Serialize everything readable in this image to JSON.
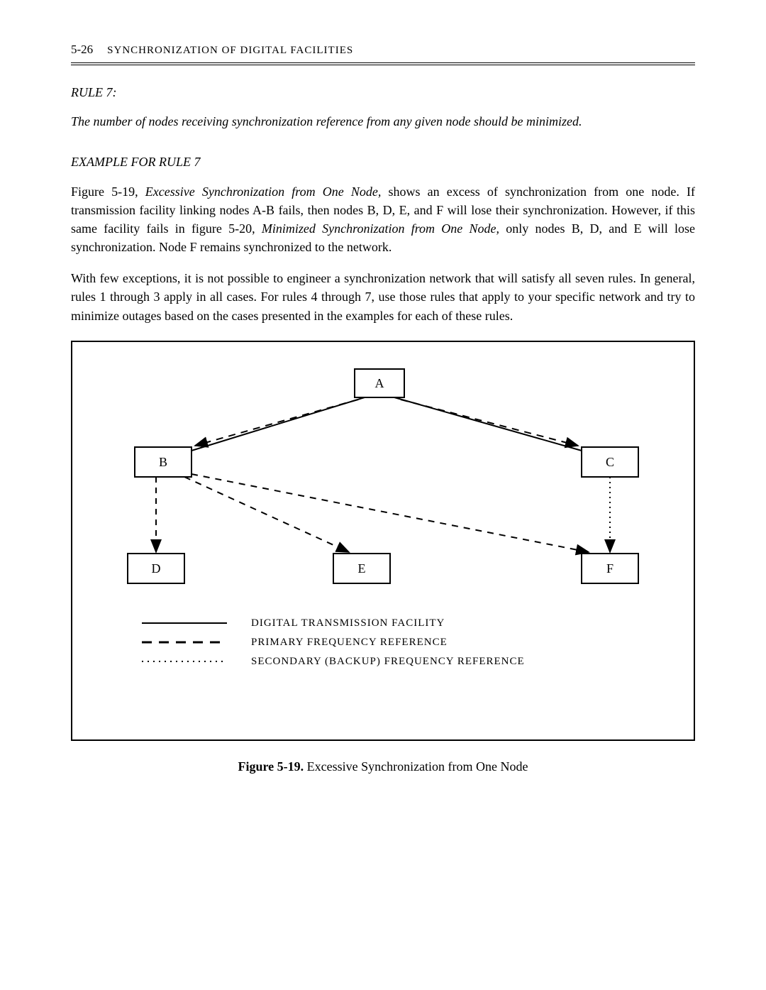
{
  "header": {
    "page_number": "5-26",
    "title": "SYNCHRONIZATION OF DIGITAL FACILITIES"
  },
  "rule": {
    "heading": "RULE 7:",
    "text": "The number of nodes receiving synchronization reference from any given node should be minimized."
  },
  "example": {
    "heading": "EXAMPLE FOR RULE 7",
    "para1_prefix": "Figure 5-19, ",
    "para1_em1": "Excessive Synchronization from One Node,",
    "para1_mid1": " shows an excess of synchronization from one node. If transmission facility linking nodes A-B fails, then nodes B, D, E, and F will lose their synchronization. However, if this same facility fails in figure 5-20, ",
    "para1_em2": "Minimized Synchronization from One Node,",
    "para1_suffix": " only nodes B, D, and E will lose synchronization. Node F remains synchronized to the network.",
    "para2": "With few exceptions, it is not possible to engineer a synchronization network that will satisfy all seven rules. In general, rules 1 through 3 apply in all cases. For rules 4 through 7, use those rules that apply to your specific network and try to minimize outages based on the cases presented in the examples for each of these rules."
  },
  "diagram": {
    "nodes": {
      "A": "A",
      "B": "B",
      "C": "C",
      "D": "D",
      "E": "E",
      "F": "F"
    },
    "legend": {
      "solid": "DIGITAL TRANSMISSION FACILITY",
      "dashed": "PRIMARY FREQUENCY REFERENCE",
      "dotted": "SECONDARY (BACKUP) FREQUENCY REFERENCE"
    }
  },
  "caption": {
    "label": "Figure 5-19.",
    "text": " Excessive Synchronization from One Node"
  }
}
